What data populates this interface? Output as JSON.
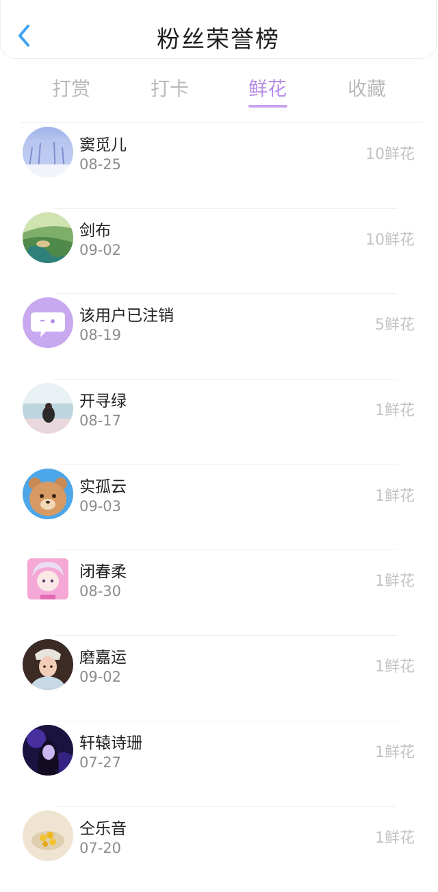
{
  "header": {
    "title": "粉丝荣誉榜",
    "back_icon": "chevron-left-icon"
  },
  "tabs": [
    {
      "label": "打赏",
      "active": false
    },
    {
      "label": "打卡",
      "active": false
    },
    {
      "label": "鲜花",
      "active": true
    },
    {
      "label": "收藏",
      "active": false
    }
  ],
  "colors": {
    "accent": "#b58ce6",
    "back": "#3ea0f0",
    "inactive_tab": "#b9b9b9"
  },
  "fans": [
    {
      "name": "窦觅儿",
      "date": "08-25",
      "amount": "10鲜花",
      "avatar": "avatar-snowy-trees"
    },
    {
      "name": "剑布",
      "date": "09-02",
      "amount": "10鲜花",
      "avatar": "avatar-landscape"
    },
    {
      "name": "该用户已注销",
      "date": "08-19",
      "amount": "5鲜花",
      "avatar": "avatar-deleted-chat"
    },
    {
      "name": "开寻绿",
      "date": "08-17",
      "amount": "1鲜花",
      "avatar": "avatar-girl-sea"
    },
    {
      "name": "实孤云",
      "date": "09-03",
      "amount": "1鲜花",
      "avatar": "avatar-bear"
    },
    {
      "name": "闭春柔",
      "date": "08-30",
      "amount": "1鲜花",
      "avatar": "avatar-anime-girl"
    },
    {
      "name": "磨嘉运",
      "date": "09-02",
      "amount": "1鲜花",
      "avatar": "avatar-girl-hat"
    },
    {
      "name": "轩辕诗珊",
      "date": "07-27",
      "amount": "1鲜花",
      "avatar": "avatar-purple-girl"
    },
    {
      "name": "仝乐音",
      "date": "07-20",
      "amount": "1鲜花",
      "avatar": "avatar-flowers"
    }
  ]
}
